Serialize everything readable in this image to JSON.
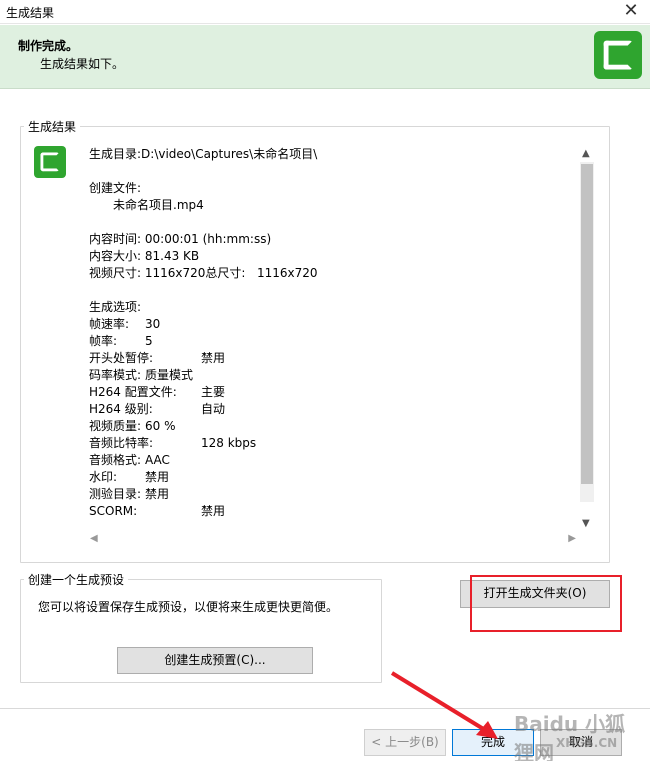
{
  "window": {
    "title": "生成结果",
    "close_glyph": "✕"
  },
  "banner": {
    "heading": "制作完成。",
    "subtext": "生成结果如下。"
  },
  "results": {
    "legend": "生成结果",
    "output_dir_label": "生成目录:",
    "output_dir": "D:\\video\\Captures\\未命名项目\\",
    "created_files_label": "创建文件:",
    "created_file": "未命名项目.mp4",
    "duration_label": "内容时间:",
    "duration_value": "00:00:01 (hh:mm:ss)",
    "size_label": "内容大小:",
    "size_value": "81.43 KB",
    "video_dims_label": "视频尺寸:",
    "video_dims_value": "1116x720",
    "total_dims_label": "总尺寸:",
    "total_dims_value": "1116x720",
    "options_label": "生成选项:",
    "options": [
      {
        "label": "帧速率:",
        "value": "30"
      },
      {
        "label": "帧率:",
        "value": "5"
      },
      {
        "label": "开头处暂停:",
        "value": "禁用"
      },
      {
        "label": "码率模式:",
        "value": "质量模式"
      },
      {
        "label": "H264 配置文件:",
        "value": "主要"
      },
      {
        "label": "H264 级别:",
        "value": "自动"
      },
      {
        "label": "视频质量:",
        "value": "60 %"
      },
      {
        "label": "音频比特率:",
        "value": "128 kbps"
      },
      {
        "label": "音频格式:",
        "value": "AAC"
      },
      {
        "label": "水印:",
        "value": "禁用"
      },
      {
        "label": "测验目录:",
        "value": "禁用"
      },
      {
        "label": "SCORM:",
        "value": "禁用"
      }
    ]
  },
  "preset": {
    "legend": "创建一个生成预设",
    "description": "您可以将设置保存生成预设，以便将来生成更快更简便。",
    "create_button": "创建生成预置(C)..."
  },
  "buttons": {
    "open_folder": "打开生成文件夹(O)",
    "prev": "< 上一步(B)",
    "finish": "完成",
    "cancel": "取消"
  },
  "watermark": {
    "line1": "Baidu 小狐狸网",
    "line2": "XHGS.CN"
  },
  "colors": {
    "banner_bg": "#dff0e0",
    "logo_green": "#2fa52f",
    "highlight_red": "#e8202a"
  }
}
